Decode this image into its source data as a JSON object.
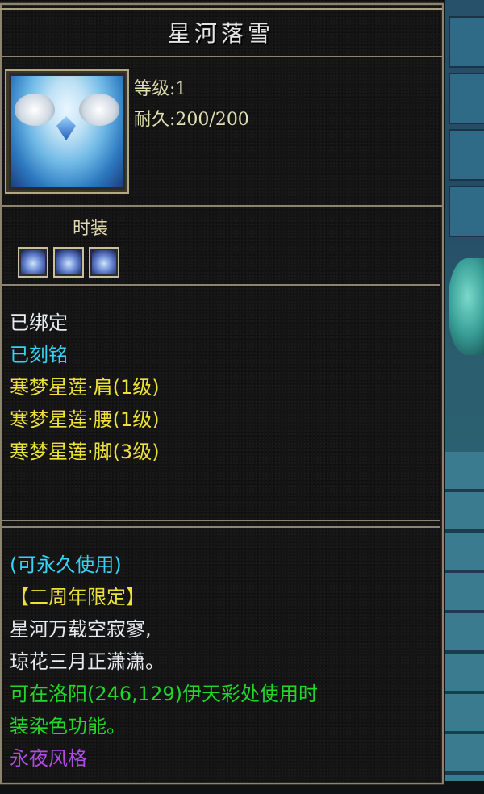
{
  "tooltip": {
    "title": "星河落雪",
    "item_icon": "fashion-robe-icon",
    "stats": {
      "level": "等级:1",
      "durability": "耐久:200/200"
    },
    "category": "时装",
    "socket_icons": [
      "gem-slot-icon",
      "gem-slot-icon",
      "gem-slot-icon"
    ],
    "attributes": [
      {
        "text": "已绑定",
        "color": "#e6ebef"
      },
      {
        "text": "已刻铭",
        "color": "#36d3f2"
      },
      {
        "text": "寒梦星莲·肩(1级)",
        "color": "#ede13a"
      },
      {
        "text": "寒梦星莲·腰(1级)",
        "color": "#ede13a"
      },
      {
        "text": "寒梦星莲·脚(3级)",
        "color": "#ede13a"
      }
    ],
    "description": [
      {
        "text": "(可永久使用)",
        "color": "#36d3f2"
      },
      {
        "text": "【二周年限定】",
        "color": "#ede13a"
      },
      {
        "text": "星河万载空寂寥,",
        "color": "#e6ebef"
      },
      {
        "text": "琼花三月正潇潇。",
        "color": "#e6ebef"
      },
      {
        "text": "可在洛阳(246,129)伊天彩处使用时",
        "color": "#22d72a"
      },
      {
        "text": "装染色功能。",
        "color": "#22d72a"
      },
      {
        "text": "永夜风格",
        "color": "#b14be6"
      }
    ]
  },
  "colors": {
    "frame": "#8d8470",
    "panel_bg": "#141414"
  }
}
